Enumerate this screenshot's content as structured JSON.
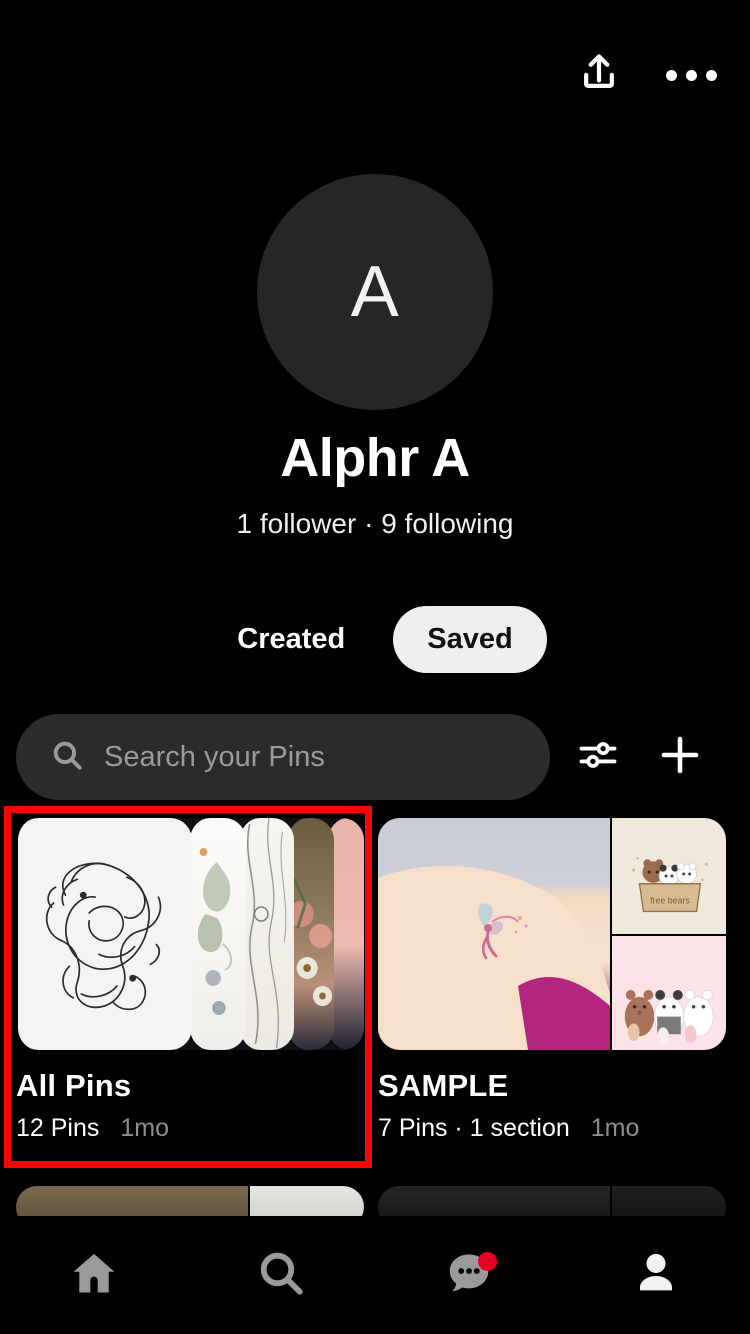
{
  "header": {
    "share_icon": "share-upload-icon",
    "overflow_icon": "three-dots-menu-icon"
  },
  "profile": {
    "avatar_initial": "A",
    "avatar_bg": "#262626",
    "name": "Alphr A",
    "stats": "1 follower · 9 following",
    "followers": 1,
    "following": 9
  },
  "tabs": [
    {
      "label": "Created",
      "active": false
    },
    {
      "label": "Saved",
      "active": true
    }
  ],
  "search": {
    "placeholder": "Search your Pins",
    "value": "",
    "icon": "search-icon",
    "filter_icon": "filter-sliders-icon",
    "add_icon": "plus-icon"
  },
  "boards": [
    {
      "title": "All Pins",
      "count_label": "12 Pins",
      "age": "1mo",
      "pins": 12,
      "sections": 0,
      "highlighted": true,
      "cover_type": "stacked-cards",
      "cover_description": "Koi fish line art drawing with stacked preview cards"
    },
    {
      "title": "SAMPLE",
      "count_label": "7 Pins · 1 section",
      "age": "1mo",
      "pins": 7,
      "sections": 1,
      "highlighted": false,
      "cover_type": "mosaic",
      "cover_description": "Fairy shoulder tattoo photo with two cartoon bear images"
    }
  ],
  "annotation": {
    "color": "#f80505",
    "target": "All Pins board"
  },
  "bottom_nav": [
    {
      "name": "home",
      "icon": "home-icon",
      "active": false,
      "badge": false
    },
    {
      "name": "search",
      "icon": "search-icon",
      "active": false,
      "badge": false
    },
    {
      "name": "messages",
      "icon": "chat-bubble-icon",
      "active": false,
      "badge": true
    },
    {
      "name": "profile",
      "icon": "person-icon",
      "active": true,
      "badge": false
    }
  ]
}
